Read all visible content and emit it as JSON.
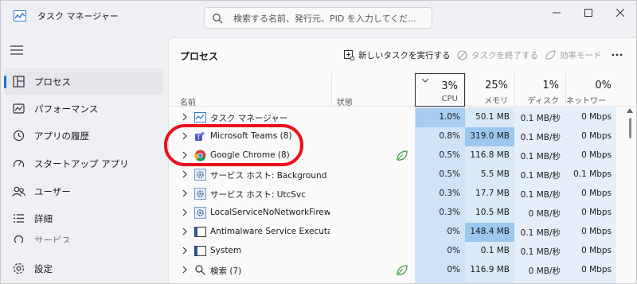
{
  "window": {
    "title": "タスク マネージャー"
  },
  "search": {
    "placeholder": "検索する名前、発行元、PID を入力してくだ..."
  },
  "sidebar": {
    "items": [
      {
        "label": "プロセス",
        "icon": "processes-icon",
        "active": true
      },
      {
        "label": "パフォーマンス",
        "icon": "performance-icon"
      },
      {
        "label": "アプリの履歴",
        "icon": "history-icon"
      },
      {
        "label": "スタートアップ アプリ",
        "icon": "startup-icon"
      },
      {
        "label": "ユーザー",
        "icon": "users-icon"
      },
      {
        "label": "詳細",
        "icon": "details-icon"
      },
      {
        "label": "サービス",
        "icon": "services-icon"
      }
    ],
    "settings_label": "設定"
  },
  "main": {
    "title": "プロセス",
    "toolbar": {
      "new_task": "新しいタスクを実行する",
      "end_task": "タスクを終了する",
      "efficiency": "効率モード"
    },
    "headers": {
      "name": "名前",
      "status": "状態",
      "cpu_pct": "3%",
      "cpu_label": "CPU",
      "mem_pct": "25%",
      "mem_label": "メモリ",
      "disk_pct": "1%",
      "disk_label": "ディスク",
      "net_pct": "0%",
      "net_label": "ネットワーク"
    },
    "rows": [
      {
        "name": "タスク マネージャー",
        "icon": "taskmanager-icon",
        "cpu": "1.0%",
        "mem": "50.1 MB",
        "disk": "0.1 MB/秒",
        "net": "0 Mbps"
      },
      {
        "name": "Microsoft Teams (8)",
        "icon": "teams-icon",
        "cpu": "0.8%",
        "mem": "319.0 MB",
        "disk": "0.1 MB/秒",
        "net": "0 Mbps"
      },
      {
        "name": "Google Chrome (8)",
        "icon": "chrome-icon",
        "cpu": "0.5%",
        "mem": "116.8 MB",
        "disk": "0.1 MB/秒",
        "net": "0 Mbps",
        "status_icon": "efficiency-leaf-icon"
      },
      {
        "name": "サービス ホスト: Background Inte...",
        "icon": "service-gear-icon",
        "cpu": "0.5%",
        "mem": "5.5 MB",
        "disk": "0.1 MB/秒",
        "net": "0.1 Mbps"
      },
      {
        "name": "サービス ホスト: UtcSvc",
        "icon": "service-gear-icon",
        "cpu": "0.3%",
        "mem": "17.7 MB",
        "disk": "0.1 MB/秒",
        "net": "0 Mbps"
      },
      {
        "name": "LocalServiceNoNetworkFirewa...",
        "icon": "service-gear-icon",
        "cpu": "0.3%",
        "mem": "10.5 MB",
        "disk": "0 MB/秒",
        "net": "0 Mbps"
      },
      {
        "name": "Antimalware Service Executable",
        "icon": "window-app-icon",
        "cpu": "0%",
        "mem": "148.4 MB",
        "disk": "0.1 MB/秒",
        "net": "0 Mbps"
      },
      {
        "name": "System",
        "icon": "window-app-icon",
        "cpu": "0%",
        "mem": "0.1 MB",
        "disk": "0.1 MB/秒",
        "net": "0 Mbps"
      },
      {
        "name": "検索 (7)",
        "icon": "search-icon",
        "cpu": "0%",
        "mem": "116.9 MB",
        "disk": "0 MB/秒",
        "net": "0 Mbps",
        "status_icon": "efficiency-leaf-icon"
      }
    ]
  },
  "colors": {
    "cpu_cell": "#cfe3f7",
    "cpu_cell_hot": "#a8cdf0",
    "mem_cell": "#cfe3f7",
    "mem_cell_hot": "#9cc8ef",
    "annotation": "#e8111b",
    "leaf": "#3a9a3a"
  }
}
